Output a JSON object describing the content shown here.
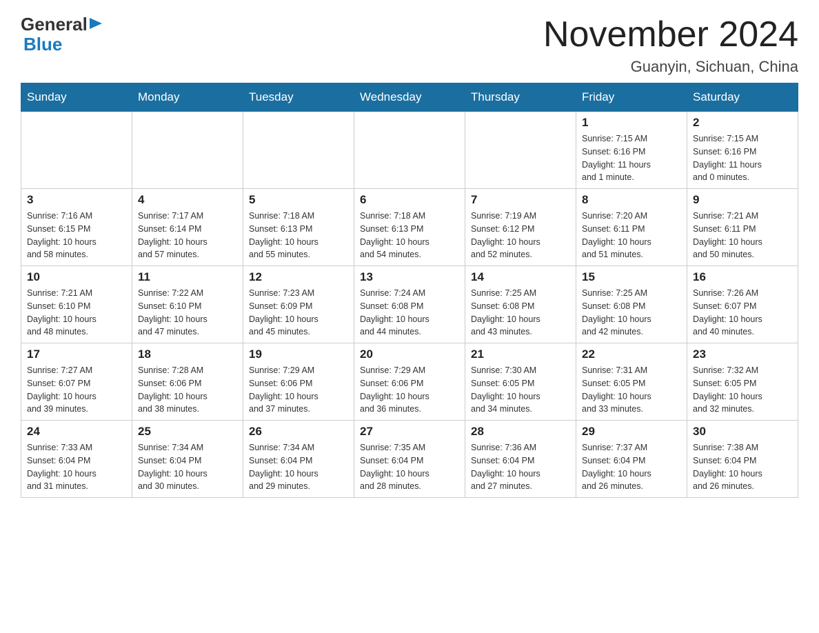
{
  "logo": {
    "general": "General",
    "blue": "Blue"
  },
  "title": "November 2024",
  "subtitle": "Guanyin, Sichuan, China",
  "days_of_week": [
    "Sunday",
    "Monday",
    "Tuesday",
    "Wednesday",
    "Thursday",
    "Friday",
    "Saturday"
  ],
  "weeks": [
    {
      "days": [
        {
          "number": "",
          "info": ""
        },
        {
          "number": "",
          "info": ""
        },
        {
          "number": "",
          "info": ""
        },
        {
          "number": "",
          "info": ""
        },
        {
          "number": "",
          "info": ""
        },
        {
          "number": "1",
          "info": "Sunrise: 7:15 AM\nSunset: 6:16 PM\nDaylight: 11 hours\nand 1 minute."
        },
        {
          "number": "2",
          "info": "Sunrise: 7:15 AM\nSunset: 6:16 PM\nDaylight: 11 hours\nand 0 minutes."
        }
      ]
    },
    {
      "days": [
        {
          "number": "3",
          "info": "Sunrise: 7:16 AM\nSunset: 6:15 PM\nDaylight: 10 hours\nand 58 minutes."
        },
        {
          "number": "4",
          "info": "Sunrise: 7:17 AM\nSunset: 6:14 PM\nDaylight: 10 hours\nand 57 minutes."
        },
        {
          "number": "5",
          "info": "Sunrise: 7:18 AM\nSunset: 6:13 PM\nDaylight: 10 hours\nand 55 minutes."
        },
        {
          "number": "6",
          "info": "Sunrise: 7:18 AM\nSunset: 6:13 PM\nDaylight: 10 hours\nand 54 minutes."
        },
        {
          "number": "7",
          "info": "Sunrise: 7:19 AM\nSunset: 6:12 PM\nDaylight: 10 hours\nand 52 minutes."
        },
        {
          "number": "8",
          "info": "Sunrise: 7:20 AM\nSunset: 6:11 PM\nDaylight: 10 hours\nand 51 minutes."
        },
        {
          "number": "9",
          "info": "Sunrise: 7:21 AM\nSunset: 6:11 PM\nDaylight: 10 hours\nand 50 minutes."
        }
      ]
    },
    {
      "days": [
        {
          "number": "10",
          "info": "Sunrise: 7:21 AM\nSunset: 6:10 PM\nDaylight: 10 hours\nand 48 minutes."
        },
        {
          "number": "11",
          "info": "Sunrise: 7:22 AM\nSunset: 6:10 PM\nDaylight: 10 hours\nand 47 minutes."
        },
        {
          "number": "12",
          "info": "Sunrise: 7:23 AM\nSunset: 6:09 PM\nDaylight: 10 hours\nand 45 minutes."
        },
        {
          "number": "13",
          "info": "Sunrise: 7:24 AM\nSunset: 6:08 PM\nDaylight: 10 hours\nand 44 minutes."
        },
        {
          "number": "14",
          "info": "Sunrise: 7:25 AM\nSunset: 6:08 PM\nDaylight: 10 hours\nand 43 minutes."
        },
        {
          "number": "15",
          "info": "Sunrise: 7:25 AM\nSunset: 6:08 PM\nDaylight: 10 hours\nand 42 minutes."
        },
        {
          "number": "16",
          "info": "Sunrise: 7:26 AM\nSunset: 6:07 PM\nDaylight: 10 hours\nand 40 minutes."
        }
      ]
    },
    {
      "days": [
        {
          "number": "17",
          "info": "Sunrise: 7:27 AM\nSunset: 6:07 PM\nDaylight: 10 hours\nand 39 minutes."
        },
        {
          "number": "18",
          "info": "Sunrise: 7:28 AM\nSunset: 6:06 PM\nDaylight: 10 hours\nand 38 minutes."
        },
        {
          "number": "19",
          "info": "Sunrise: 7:29 AM\nSunset: 6:06 PM\nDaylight: 10 hours\nand 37 minutes."
        },
        {
          "number": "20",
          "info": "Sunrise: 7:29 AM\nSunset: 6:06 PM\nDaylight: 10 hours\nand 36 minutes."
        },
        {
          "number": "21",
          "info": "Sunrise: 7:30 AM\nSunset: 6:05 PM\nDaylight: 10 hours\nand 34 minutes."
        },
        {
          "number": "22",
          "info": "Sunrise: 7:31 AM\nSunset: 6:05 PM\nDaylight: 10 hours\nand 33 minutes."
        },
        {
          "number": "23",
          "info": "Sunrise: 7:32 AM\nSunset: 6:05 PM\nDaylight: 10 hours\nand 32 minutes."
        }
      ]
    },
    {
      "days": [
        {
          "number": "24",
          "info": "Sunrise: 7:33 AM\nSunset: 6:04 PM\nDaylight: 10 hours\nand 31 minutes."
        },
        {
          "number": "25",
          "info": "Sunrise: 7:34 AM\nSunset: 6:04 PM\nDaylight: 10 hours\nand 30 minutes."
        },
        {
          "number": "26",
          "info": "Sunrise: 7:34 AM\nSunset: 6:04 PM\nDaylight: 10 hours\nand 29 minutes."
        },
        {
          "number": "27",
          "info": "Sunrise: 7:35 AM\nSunset: 6:04 PM\nDaylight: 10 hours\nand 28 minutes."
        },
        {
          "number": "28",
          "info": "Sunrise: 7:36 AM\nSunset: 6:04 PM\nDaylight: 10 hours\nand 27 minutes."
        },
        {
          "number": "29",
          "info": "Sunrise: 7:37 AM\nSunset: 6:04 PM\nDaylight: 10 hours\nand 26 minutes."
        },
        {
          "number": "30",
          "info": "Sunrise: 7:38 AM\nSunset: 6:04 PM\nDaylight: 10 hours\nand 26 minutes."
        }
      ]
    }
  ]
}
